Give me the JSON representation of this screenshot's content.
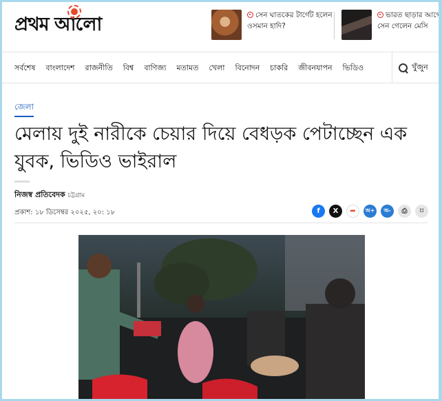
{
  "header": {
    "logo_text": "প্রথম আলো",
    "promos": [
      {
        "text": "সেন ঘাতকের টার্গেট হলেন ওসমান হাদি?",
        "thumb_color": "#b77845"
      },
      {
        "text": "ভারত ছাড়ার আগে বাড়িতে সেন গেলেন মেসি",
        "thumb_color": "#3b3030"
      }
    ]
  },
  "nav": {
    "items": [
      "সর্বশেষ",
      "বাংলাদেশ",
      "রাজনীতি",
      "বিশ্ব",
      "বাণিজ্য",
      "মতামত",
      "খেলা",
      "বিনোদন",
      "চাকরি",
      "জীবনযাপন",
      "ভিডিও"
    ],
    "search_label": "খুঁজুন"
  },
  "article": {
    "section": "জেলা",
    "headline": "মেলায় দুই নারীকে চেয়ার দিয়ে বেধড়ক পেটাচ্ছেন এক যুবক, ভিডিও ভাইরাল",
    "author": "নিজস্ব প্রতিবেদক",
    "location": "চট্টগ্রাম",
    "published": "প্রকাশ: ১৮ ডিসেম্বর ২০২৫, ২০: ১৮"
  },
  "share": {
    "buttons": [
      {
        "name": "facebook",
        "glyph": "f",
        "color": "#1877f2"
      },
      {
        "name": "x",
        "glyph": "X",
        "color": "#111111"
      },
      {
        "name": "share",
        "glyph": "➦",
        "color": "#e8482b"
      },
      {
        "name": "font-increase",
        "glyph": "অ+",
        "color": "#2b7cd3"
      },
      {
        "name": "font-decrease",
        "glyph": "অ-",
        "color": "#2b7cd3"
      },
      {
        "name": "print",
        "glyph": "⎙",
        "color": "#666666"
      },
      {
        "name": "bookmark",
        "glyph": "⌑",
        "color": "#888888"
      }
    ]
  },
  "colors": {
    "brand_red": "#e8482b",
    "link_blue": "#1a5cbf"
  }
}
